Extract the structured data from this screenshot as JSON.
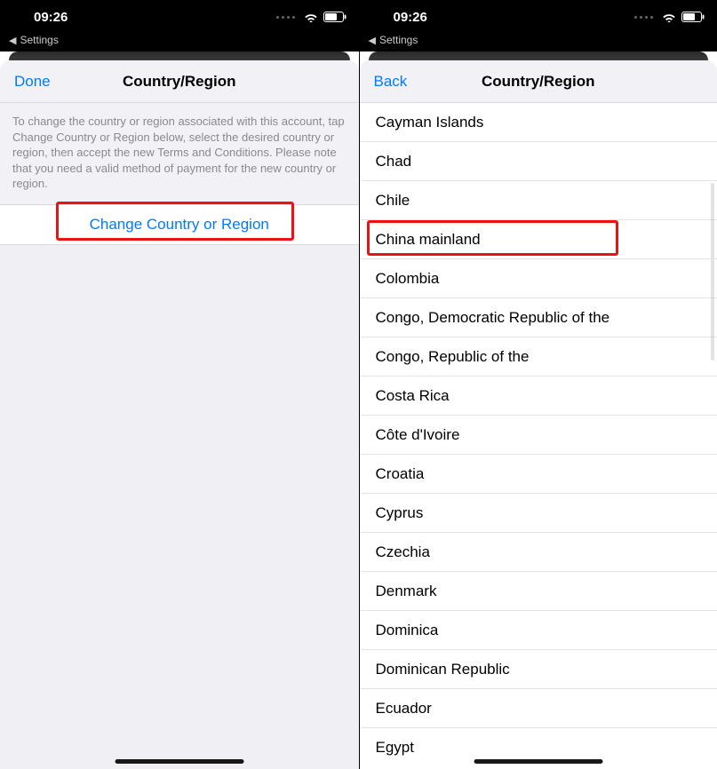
{
  "statusbar": {
    "time": "09:26"
  },
  "back_app": {
    "label": "Settings"
  },
  "left_screen": {
    "nav": {
      "left": "Done",
      "title": "Country/Region"
    },
    "description": "To change the country or region associated with this account, tap Change Country or Region below, select the desired country or region, then accept the new Terms and Conditions. Please note that you need a valid method of payment for the new country or region.",
    "change_button": "Change Country or Region"
  },
  "right_screen": {
    "nav": {
      "left": "Back",
      "title": "Country/Region"
    },
    "countries": [
      "Cayman Islands",
      "Chad",
      "Chile",
      "China mainland",
      "Colombia",
      "Congo, Democratic Republic of the",
      "Congo, Republic of the",
      "Costa Rica",
      "Côte d'Ivoire",
      "Croatia",
      "Cyprus",
      "Czechia",
      "Denmark",
      "Dominica",
      "Dominican Republic",
      "Ecuador",
      "Egypt"
    ],
    "highlight_index": 3
  }
}
